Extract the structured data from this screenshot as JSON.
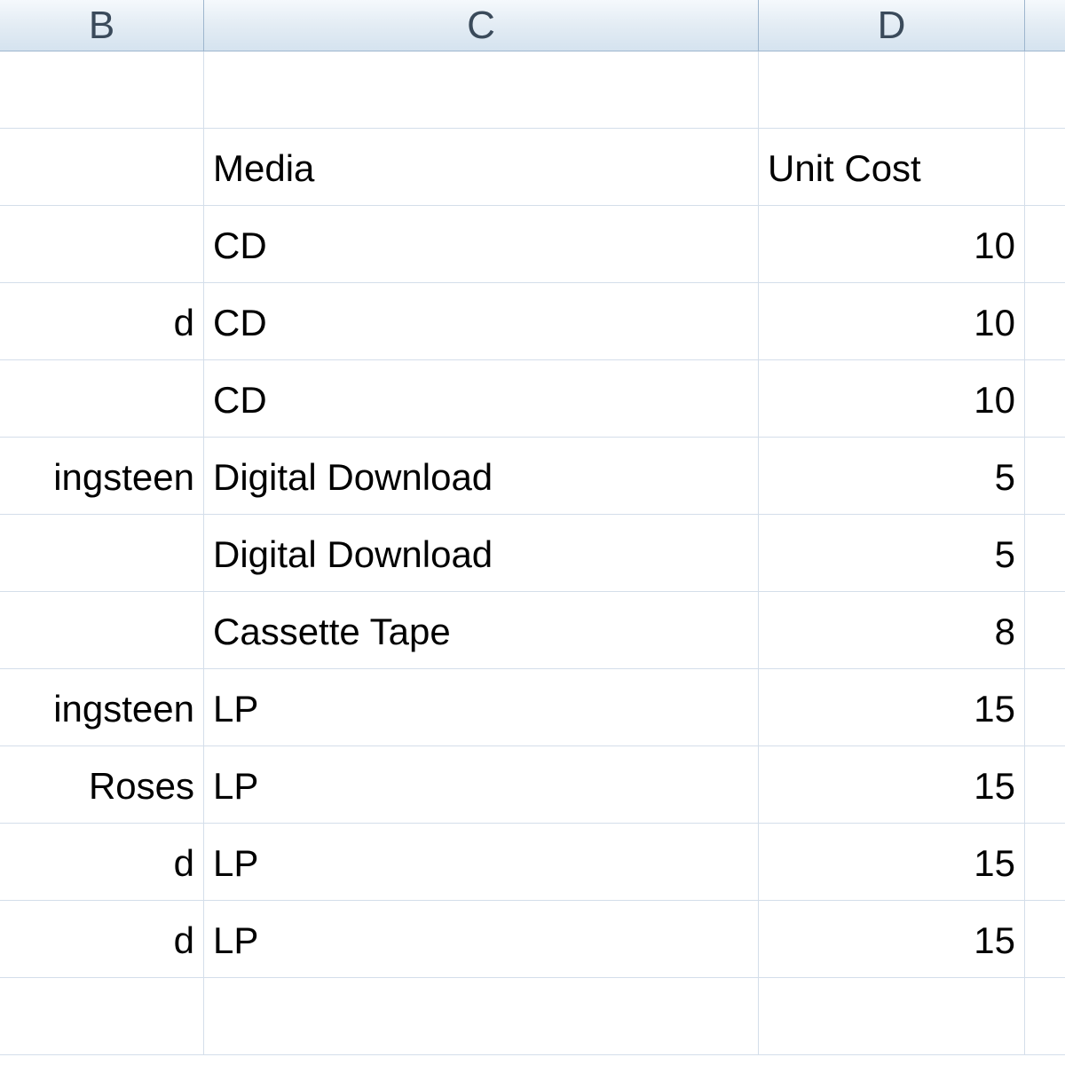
{
  "columns": {
    "b": "B",
    "c": "C",
    "d": "D",
    "e": ""
  },
  "headers": {
    "c": "Media",
    "d": "Unit Cost"
  },
  "rows": [
    {
      "b": "",
      "c": "CD",
      "d": "10"
    },
    {
      "b": "d",
      "c": "CD",
      "d": "10"
    },
    {
      "b": "",
      "c": "CD",
      "d": "10"
    },
    {
      "b": "ingsteen",
      "c": "Digital Download",
      "d": "5"
    },
    {
      "b": "",
      "c": "Digital Download",
      "d": "5"
    },
    {
      "b": "",
      "c": "Cassette Tape",
      "d": "8"
    },
    {
      "b": "ingsteen",
      "c": "LP",
      "d": "15"
    },
    {
      "b": " Roses",
      "c": "LP",
      "d": "15"
    },
    {
      "b": "d",
      "c": "LP",
      "d": "15"
    },
    {
      "b": "d",
      "c": "LP",
      "d": "15"
    }
  ]
}
